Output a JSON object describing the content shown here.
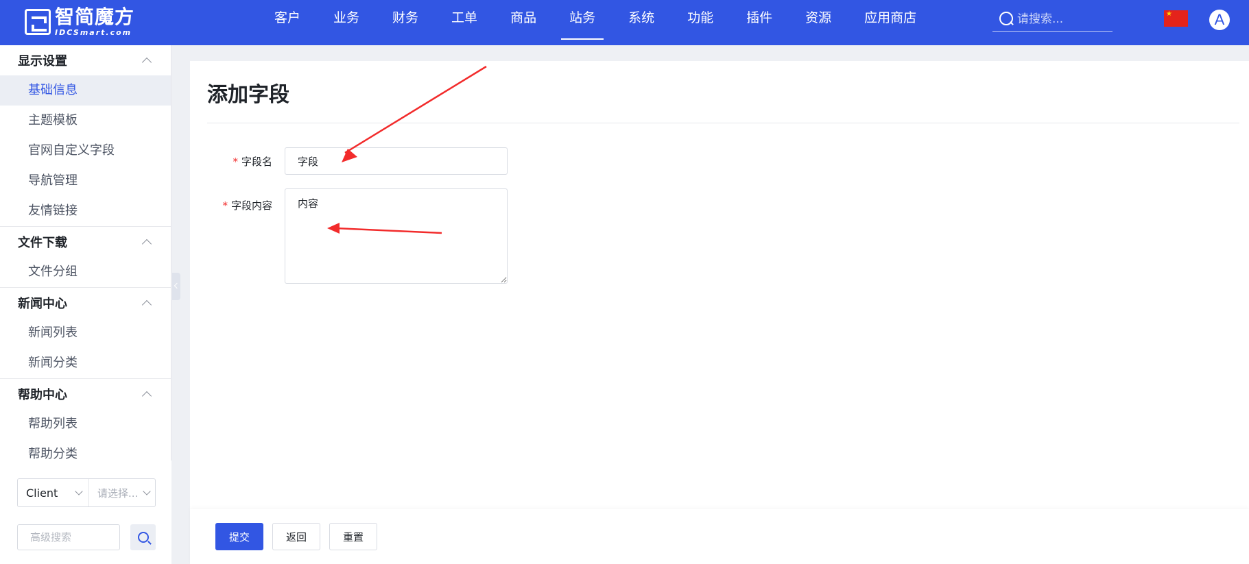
{
  "brand": {
    "name": "智简魔方",
    "sub": "IDCSmart.com"
  },
  "nav": {
    "items": [
      "客户",
      "业务",
      "财务",
      "工单",
      "商品",
      "站务",
      "系统",
      "功能",
      "插件",
      "资源",
      "应用商店"
    ],
    "active_index": 5
  },
  "search": {
    "placeholder": "请搜索..."
  },
  "user": {
    "avatar_letter": "A"
  },
  "sidebar": {
    "groups": [
      {
        "title": "显示设置",
        "items": [
          "基础信息",
          "主题模板",
          "官网自定义字段",
          "导航管理",
          "友情链接"
        ]
      },
      {
        "title": "文件下载",
        "items": [
          "文件分组"
        ]
      },
      {
        "title": "新闻中心",
        "items": [
          "新闻列表",
          "新闻分类"
        ]
      },
      {
        "title": "帮助中心",
        "items": [
          "帮助列表",
          "帮助分类"
        ]
      }
    ],
    "active_item": "基础信息",
    "filter": {
      "scope_value": "Client",
      "select_placeholder": "请选择...",
      "search_placeholder": "高级搜索"
    }
  },
  "form": {
    "title": "添加字段",
    "field_name_label": "字段名",
    "field_name_value": "字段",
    "field_content_label": "字段内容",
    "field_content_value": "内容",
    "required_mark": "*"
  },
  "actions": {
    "submit": "提交",
    "back": "返回",
    "reset": "重置"
  },
  "colors": {
    "primary": "#3256e3",
    "annotation_arrow": "#f22b2b",
    "required": "#f23030"
  }
}
